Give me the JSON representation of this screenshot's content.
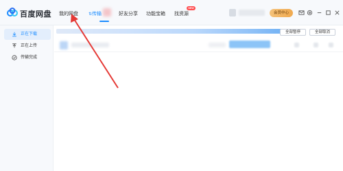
{
  "app": {
    "brand": "百度网盘"
  },
  "nav": {
    "items": [
      {
        "label": "我的网盘"
      },
      {
        "label": "传输"
      },
      {
        "label": "好友分享"
      },
      {
        "label": "功能宝箱"
      },
      {
        "label": "找资源"
      }
    ],
    "badge": "NEW"
  },
  "header": {
    "vip_label": "会员中心"
  },
  "sidebar": {
    "items": [
      {
        "label": "正在下载"
      },
      {
        "label": "正在上传"
      },
      {
        "label": "传输完成"
      }
    ]
  },
  "toolbar": {
    "pause_all": "全部暂停",
    "cancel_all": "全部取消"
  },
  "colors": {
    "accent": "#1a8cff",
    "annotation": "#e53935",
    "vip": "#f0a94e"
  }
}
